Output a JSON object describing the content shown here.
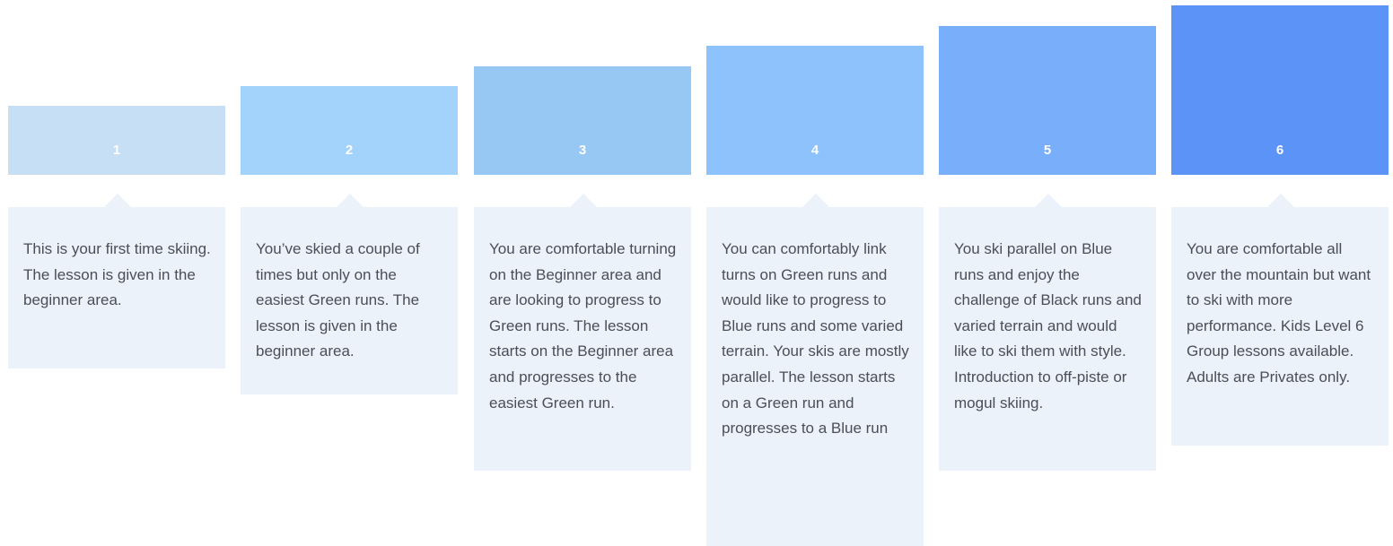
{
  "levels": [
    {
      "number": "1",
      "color": "#c7dff5",
      "description": "This is your first time skiing. The lesson is given in the beginner area."
    },
    {
      "number": "2",
      "color": "#a3d2fb",
      "description": "You’ve skied a couple of times but only on the easiest Green runs. The lesson is given in the beginner area."
    },
    {
      "number": "3",
      "color": "#97c8f3",
      "description": "You are comfortable turning on the Beginner area and are looking to progress to Green runs. The lesson starts on the Beginner area and progresses to the easiest Green run."
    },
    {
      "number": "4",
      "color": "#8ec2fc",
      "description": "You can comfortably link turns on Green runs and would like to progress to Blue runs and some varied terrain. Your skis are mostly parallel. The lesson starts on a Green run and progresses to a Blue run"
    },
    {
      "number": "5",
      "color": "#79aefb",
      "description": "You ski parallel on Blue runs and enjoy the challenge of Black runs and varied terrain and would like to ski them with style. Introduction to off-piste or mogul skiing."
    },
    {
      "number": "6",
      "color": "#5c93f6",
      "description": "You are comfortable all over the mountain but want to ski with more performance. Kids Level 6 Group lessons available. Adults are Privates only."
    }
  ]
}
